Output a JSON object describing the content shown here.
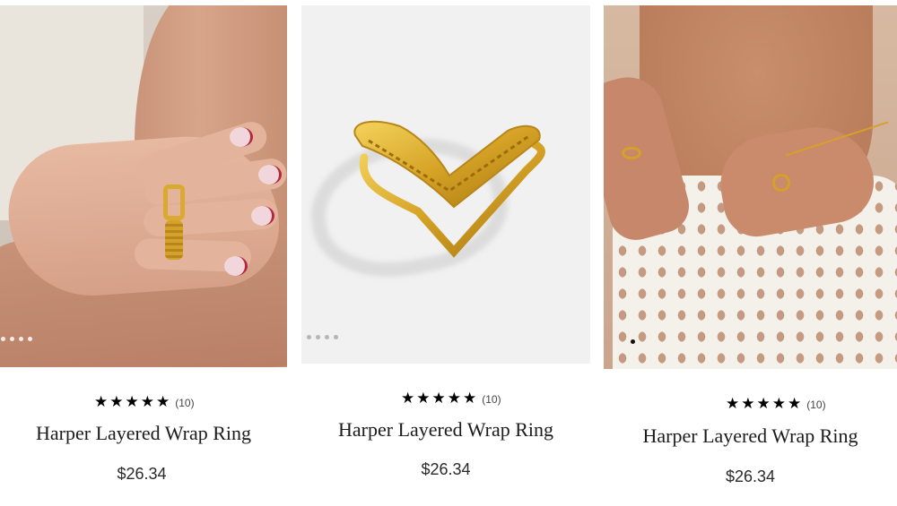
{
  "products": [
    {
      "image_alt": "hands-wearing-rings-photo",
      "dot_count": 4,
      "active_dot": -1,
      "rating_stars": 5,
      "review_count": "(10)",
      "title": "Harper Layered Wrap Ring",
      "price": "$26.34"
    },
    {
      "image_alt": "gold-layered-ring-product-photo",
      "dot_count": 4,
      "active_dot": -1,
      "rating_stars": 5,
      "review_count": "(10)",
      "title": "Harper Layered Wrap Ring",
      "price": "$26.34"
    },
    {
      "image_alt": "model-wearing-rings-photo",
      "dot_count": 1,
      "active_dot": 0,
      "rating_stars": 5,
      "review_count": "(10)",
      "title": "Harper Layered Wrap Ring",
      "price": "$26.34"
    }
  ],
  "colors": {
    "gold": "#d4a12a",
    "text": "#1c1c1c",
    "star": "#000000"
  }
}
